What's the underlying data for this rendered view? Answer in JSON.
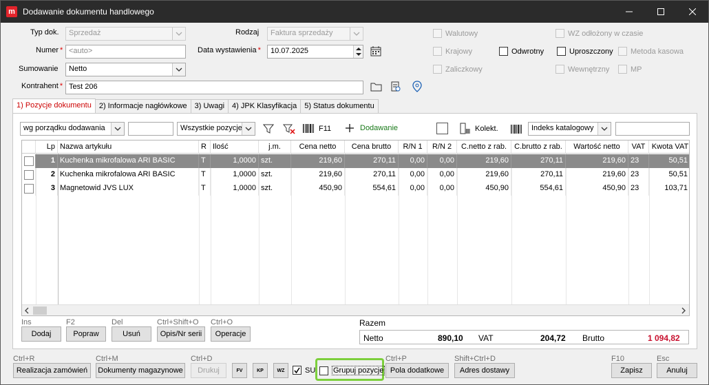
{
  "window": {
    "app_icon": "m",
    "title": "Dodawanie dokumentu handlowego",
    "controls": [
      "minimize-icon",
      "maximize-icon",
      "close-icon"
    ]
  },
  "form": {
    "typ_dok_label": "Typ dok.",
    "typ_dok_value": "Sprzedaż",
    "rodzaj_label": "Rodzaj",
    "rodzaj_value": "Faktura sprzedaży",
    "numer_label": "Numer",
    "numer_value": "<auto>",
    "data_wyst_label": "Data wystawienia",
    "data_wyst_value": "10.07.2025",
    "sumowanie_label": "Sumowanie",
    "sumowanie_value": "Netto",
    "kontrahent_label": "Kontrahent",
    "kontrahent_value": "Test 206",
    "required_mark": "*"
  },
  "options": {
    "walutowy": "Walutowy",
    "krajowy": "Krajowy",
    "zaliczkowy": "Zaliczkowy",
    "odwrotny": "Odwrotny",
    "wz_odlozony": "WZ odłożony w czasie",
    "uproszczony": "Uproszczony",
    "metoda_kasowa": "Metoda kasowa",
    "wewnetrzny": "Wewnętrzny",
    "mp": "MP"
  },
  "tabs": [
    {
      "key": "1)",
      "label": " Pozycje dokumentu"
    },
    {
      "key": "2)",
      "label": " Informacje nagłówkowe"
    },
    {
      "key": "3)",
      "label": " Uwagi"
    },
    {
      "key": "4)",
      "label": " JPK Klasyfikacja"
    },
    {
      "key": "5)",
      "label": " Status dokumentu"
    }
  ],
  "toolbar": {
    "order_value": "wg porządku dodawania",
    "filter_value": "Wszystkie pozycje",
    "f11_label": "F11",
    "add_label": "Dodawanie",
    "kolekt_label": "Kolekt.",
    "index_value": "Indeks katalogowy"
  },
  "grid": {
    "headers": [
      "Lp",
      "Nazwa artykułu",
      "R",
      "Ilość",
      "j.m.",
      "Cena netto",
      "Cena brutto",
      "R/N 1",
      "R/N 2",
      "C.netto z rab.",
      "C.brutto z rab.",
      "Wartość netto",
      "VAT",
      "Kwota VAT"
    ],
    "rows": [
      {
        "lp": "1",
        "name": "Kuchenka mikrofalowa ARI BASIC",
        "r": "T",
        "qty": "1,0000",
        "unit": "szt.",
        "net": "219,60",
        "gross": "270,11",
        "rn1": "0,00",
        "rn2": "0,00",
        "net_disc": "219,60",
        "gross_disc": "270,11",
        "value_net": "219,60",
        "vat": "23",
        "vat_amount": "50,51"
      },
      {
        "lp": "2",
        "name": "Kuchenka mikrofalowa ARI BASIC",
        "r": "T",
        "qty": "1,0000",
        "unit": "szt.",
        "net": "219,60",
        "gross": "270,11",
        "rn1": "0,00",
        "rn2": "0,00",
        "net_disc": "219,60",
        "gross_disc": "270,11",
        "value_net": "219,60",
        "vat": "23",
        "vat_amount": "50,51"
      },
      {
        "lp": "3",
        "name": "Magnetowid JVS LUX",
        "r": "T",
        "qty": "1,0000",
        "unit": "szt.",
        "net": "450,90",
        "gross": "554,61",
        "rn1": "0,00",
        "rn2": "0,00",
        "net_disc": "450,90",
        "gross_disc": "554,61",
        "value_net": "450,90",
        "vat": "23",
        "vat_amount": "103,71"
      }
    ]
  },
  "actions": {
    "dodaj_sc": "Ins",
    "dodaj": "Dodaj",
    "popraw_sc": "F2",
    "popraw": "Popraw",
    "usun_sc": "Del",
    "usun": "Usuń",
    "opis_sc": "Ctrl+Shift+O",
    "opis": "Opis/Nr serii",
    "operacje_sc": "Ctrl+O",
    "operacje": "Operacje"
  },
  "summary": {
    "title": "Razem",
    "netto_label": "Netto",
    "netto_value": "890,10",
    "vat_label": "VAT",
    "vat_value": "204,72",
    "brutto_label": "Brutto",
    "brutto_value": "1 094,82"
  },
  "bottom": {
    "realizacja_sc": "Ctrl+R",
    "realizacja": "Realizacja zamówień",
    "magazynowe_sc": "Ctrl+M",
    "magazynowe": "Dokumenty magazynowe",
    "drukuj_sc": "Ctrl+D",
    "drukuj": "Drukuj",
    "fv": "FV",
    "kp": "KP",
    "wz": "WZ",
    "su": "SU",
    "grupuj": "Grupuj pozycje",
    "pola_sc": "Ctrl+P",
    "pola": "Pola dodatkowe",
    "adres_sc": "Shift+Ctrl+D",
    "adres": "Adres dostawy",
    "zapisz_sc": "F10",
    "zapisz": "Zapisz",
    "anuluj_sc": "Esc",
    "anuluj": "Anuluj"
  },
  "colors": {
    "accent_red": "#c8102e",
    "highlight_green": "#7ccf3c",
    "selected_row": "#8a8a8a"
  }
}
